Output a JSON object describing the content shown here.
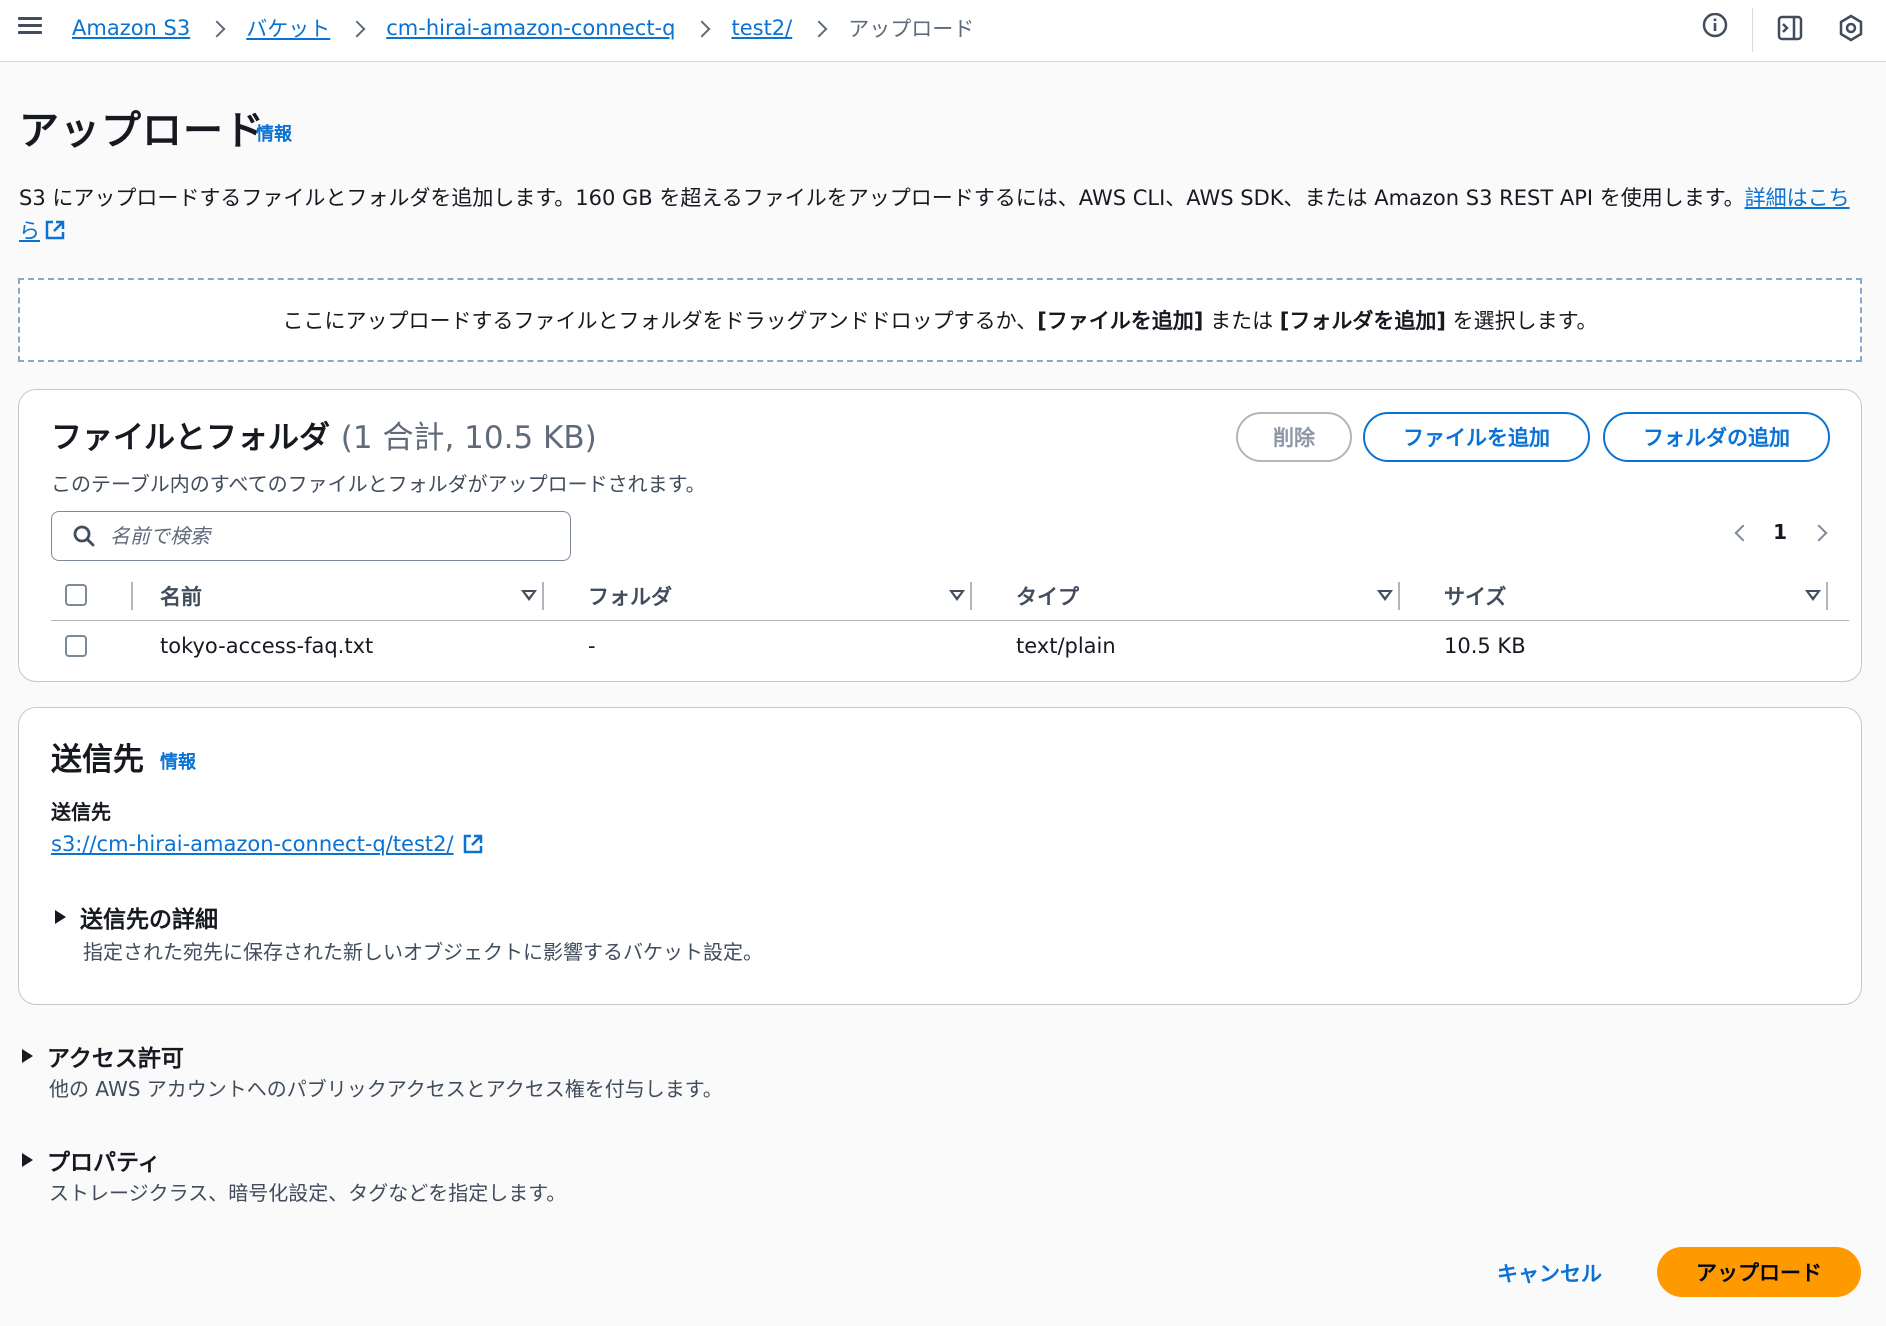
{
  "breadcrumbs": {
    "items": [
      "Amazon S3",
      "バケット",
      "cm-hirai-amazon-connect-q",
      "test2/"
    ],
    "current": "アップロード"
  },
  "icons": {
    "menu": "menu-icon",
    "info": "info-circle-icon",
    "panel": "side-panel-icon",
    "settings": "hexagon-gear-icon",
    "external": "external-link-icon",
    "search": "search-icon"
  },
  "header": {
    "title": "アップロード",
    "info_label": "情報",
    "description": "S3 にアップロードするファイルとフォルダを追加します。160 GB を超えるファイルをアップロードするには、AWS CLI、AWS SDK、または Amazon S3 REST API を使用します。",
    "learn_more_link": "詳細はこちら"
  },
  "dropzone": {
    "text_before": "ここにアップロードするファイルとフォルダをドラッグアンドドロップするか、",
    "add_files_bold": "[ファイルを追加]",
    "text_middle": " または ",
    "add_folder_bold": "[フォルダを追加]",
    "text_after": " を選択します。"
  },
  "files": {
    "title": "ファイルとフォルダ",
    "count": "(1 合計, 10.5 KB)",
    "subtitle": "このテーブル内のすべてのファイルとフォルダがアップロードされます。",
    "delete_label": "削除",
    "add_files_label": "ファイルを追加",
    "add_folder_label": "フォルダの追加",
    "search_placeholder": "名前で検索",
    "page": "1",
    "columns": [
      "名前",
      "フォルダ",
      "タイプ",
      "サイズ"
    ],
    "rows": [
      {
        "name": "tokyo-access-faq.txt",
        "folder": "-",
        "type": "text/plain",
        "size": "10.5 KB"
      }
    ]
  },
  "destination": {
    "title": "送信先",
    "info_label": "情報",
    "label": "送信先",
    "url": "s3://cm-hirai-amazon-connect-q/test2/",
    "details_title": "送信先の詳細",
    "details_desc": "指定された宛先に保存された新しいオブジェクトに影響するバケット設定。"
  },
  "permissions": {
    "title": "アクセス許可",
    "desc": "他の AWS アカウントへのパブリックアクセスとアクセス権を付与します。"
  },
  "properties": {
    "title": "プロパティ",
    "desc": "ストレージクラス、暗号化設定、タグなどを指定します。"
  },
  "footer": {
    "cancel_label": "キャンセル",
    "upload_label": "アップロード"
  },
  "colors": {
    "link": "#0972d3",
    "primary_button": "#ff9900",
    "border": "#c6c6cd"
  }
}
